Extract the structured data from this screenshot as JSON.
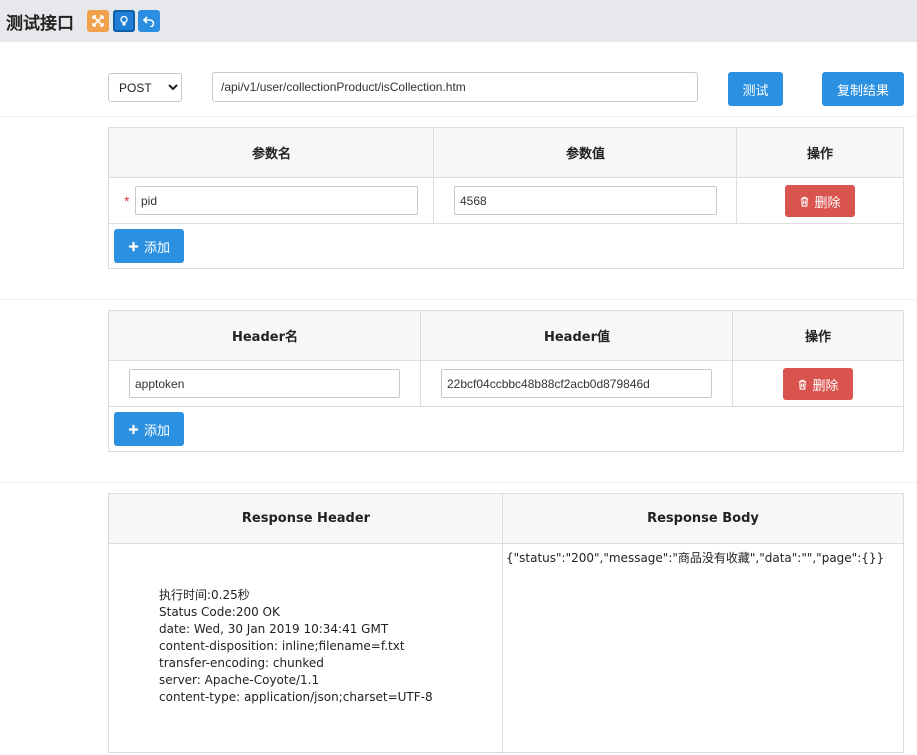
{
  "header": {
    "title": "测试接口"
  },
  "request": {
    "method": "POST",
    "method_options": [
      "POST"
    ],
    "url": "/api/v1/user/collectionProduct/isCollection.htm",
    "test_label": "测试",
    "copy_label": "复制结果"
  },
  "params": {
    "col_name": "参数名",
    "col_value": "参数值",
    "col_op": "操作",
    "rows": [
      {
        "required": "*",
        "name": "pid",
        "value": "4568",
        "delete_label": "删除"
      }
    ],
    "add_label": "添加"
  },
  "headers": {
    "col_name": "Header名",
    "col_value": "Header值",
    "col_op": "操作",
    "rows": [
      {
        "name": "apptoken",
        "value": "22bcf04ccbbc48b88cf2acb0d879846d",
        "delete_label": "删除"
      }
    ],
    "add_label": "添加"
  },
  "response": {
    "header_title": "Response Header",
    "body_title": "Response Body",
    "header_text": "执行时间:0.25秒\nStatus Code:200 OK\ndate: Wed, 30 Jan 2019 10:34:41 GMT\ncontent-disposition: inline;filename=f.txt\ntransfer-encoding: chunked\nserver: Apache-Coyote/1.1\ncontent-type: application/json;charset=UTF-8",
    "body_text": "{\"status\":\"200\",\"message\":\"商品没有收藏\",\"data\":\"\",\"page\":{}}"
  },
  "colors": {
    "topbar": "#e7e8ec",
    "primary": "#2b90e0",
    "danger": "#d9534f",
    "orange": "#f0a14b"
  }
}
